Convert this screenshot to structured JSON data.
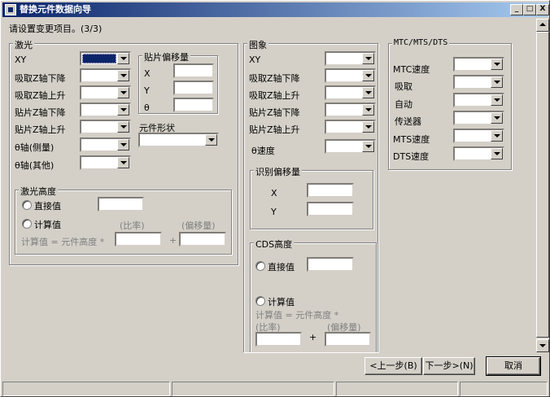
{
  "title": "替换元件数据向导",
  "prompt": "请设置变更项目。(3/3)",
  "laser": {
    "title": "激光",
    "rows": [
      "XY",
      "吸取Z轴下降",
      "吸取Z轴上升",
      "贴片Z轴下降",
      "贴片Z轴上升",
      "θ轴(侧量)",
      "θ轴(其他)"
    ]
  },
  "offset": {
    "title": "贴片偏移量",
    "x": "X",
    "y": "Y",
    "theta": "θ"
  },
  "shape": {
    "title": "元件形状"
  },
  "laser_height": {
    "title": "激光高度",
    "direct": "直接值",
    "calc": "计算值",
    "ratio": "(比率)",
    "offset": "(偏移量)",
    "formula": "计算值 = 元件高度 *",
    "plus": "+"
  },
  "image": {
    "title": "图象",
    "rows": [
      "XY",
      "吸取Z轴下降",
      "吸取Z轴上升",
      "贴片Z轴下降",
      "贴片Z轴上升",
      "θ速度"
    ]
  },
  "recog": {
    "title": "识别偏移量",
    "x": "X",
    "y": "Y"
  },
  "cds": {
    "title": "CDS高度",
    "direct": "直接值",
    "calc": "计算值",
    "formula": "计算值 = 元件高度 *",
    "ratio": "(比率)",
    "offset": "(偏移量)",
    "plus": "+"
  },
  "mtc": {
    "title": "MTC/MTS/DTS",
    "rows": [
      "MTC速度",
      "吸取",
      "自动",
      "传送器",
      "MTS速度",
      "DTS速度"
    ]
  },
  "buttons": {
    "prev": "<上一步(B)",
    "next": "下一步>(N)",
    "cancel": "取消"
  },
  "controls": {
    "min": "_",
    "max": "□",
    "close": "X"
  }
}
